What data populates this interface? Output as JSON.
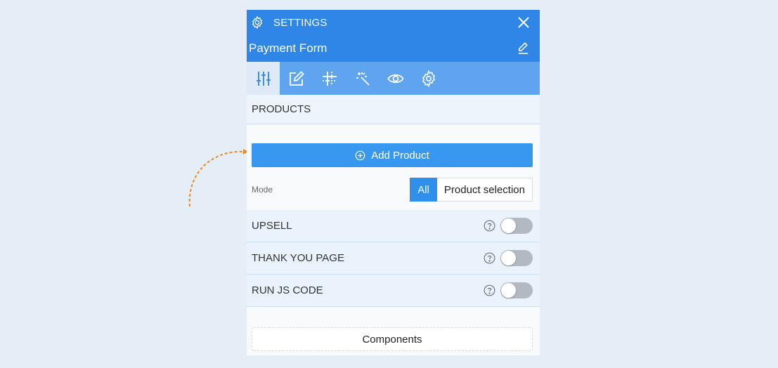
{
  "header": {
    "title": "SETTINGS",
    "form_title": "Payment Form"
  },
  "tabs": [
    {
      "icon": "sliders-icon",
      "active": true
    },
    {
      "icon": "edit-square-icon",
      "active": false
    },
    {
      "icon": "layout-grid-icon",
      "active": false
    },
    {
      "icon": "magic-wand-icon",
      "active": false
    },
    {
      "icon": "eye-icon",
      "active": false
    },
    {
      "icon": "gear-icon",
      "active": false
    }
  ],
  "products": {
    "heading": "PRODUCTS",
    "add_label": "Add Product",
    "mode_label": "Mode",
    "mode_options": [
      "All",
      "Product selection"
    ],
    "mode_selected": "All"
  },
  "toggles": [
    {
      "label": "UPSELL",
      "on": false
    },
    {
      "label": "THANK YOU PAGE",
      "on": false
    },
    {
      "label": "RUN JS CODE",
      "on": false
    }
  ],
  "components_label": "Components",
  "colors": {
    "header": "#2f86e7",
    "tabbar": "#5ea4ee",
    "primary_button": "#3898ef",
    "arrow": "#e88a2a",
    "background": "#e5edf7"
  }
}
